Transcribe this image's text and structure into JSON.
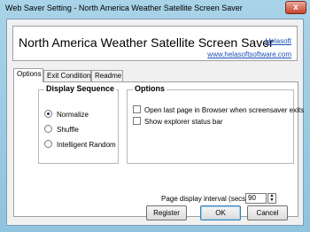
{
  "window": {
    "title": "Web Saver Setting - North America Weather Satellite Screen Saver",
    "close_glyph": "x"
  },
  "header": {
    "title": "North America Weather Satellite Screen Saver",
    "brand": "Helasoft",
    "url": "www.helasoftsoftware.com"
  },
  "tabs": [
    {
      "label": "Options"
    },
    {
      "label": "Exit Conditions"
    },
    {
      "label": "Readme"
    }
  ],
  "display_sequence": {
    "title": "Display Sequence",
    "options": [
      "Normalize",
      "Shuffle",
      "Intelligent Random"
    ],
    "selected": "Normalize"
  },
  "options_group": {
    "title": "Options",
    "checks": [
      {
        "label": "Open last page in Browser when screensaver exits",
        "checked": false
      },
      {
        "label": "Show explorer status bar",
        "checked": false
      }
    ]
  },
  "interval": {
    "label": "Page display interval (secs):",
    "value": "90"
  },
  "buttons": {
    "register": "Register",
    "ok": "OK",
    "cancel": "Cancel"
  }
}
